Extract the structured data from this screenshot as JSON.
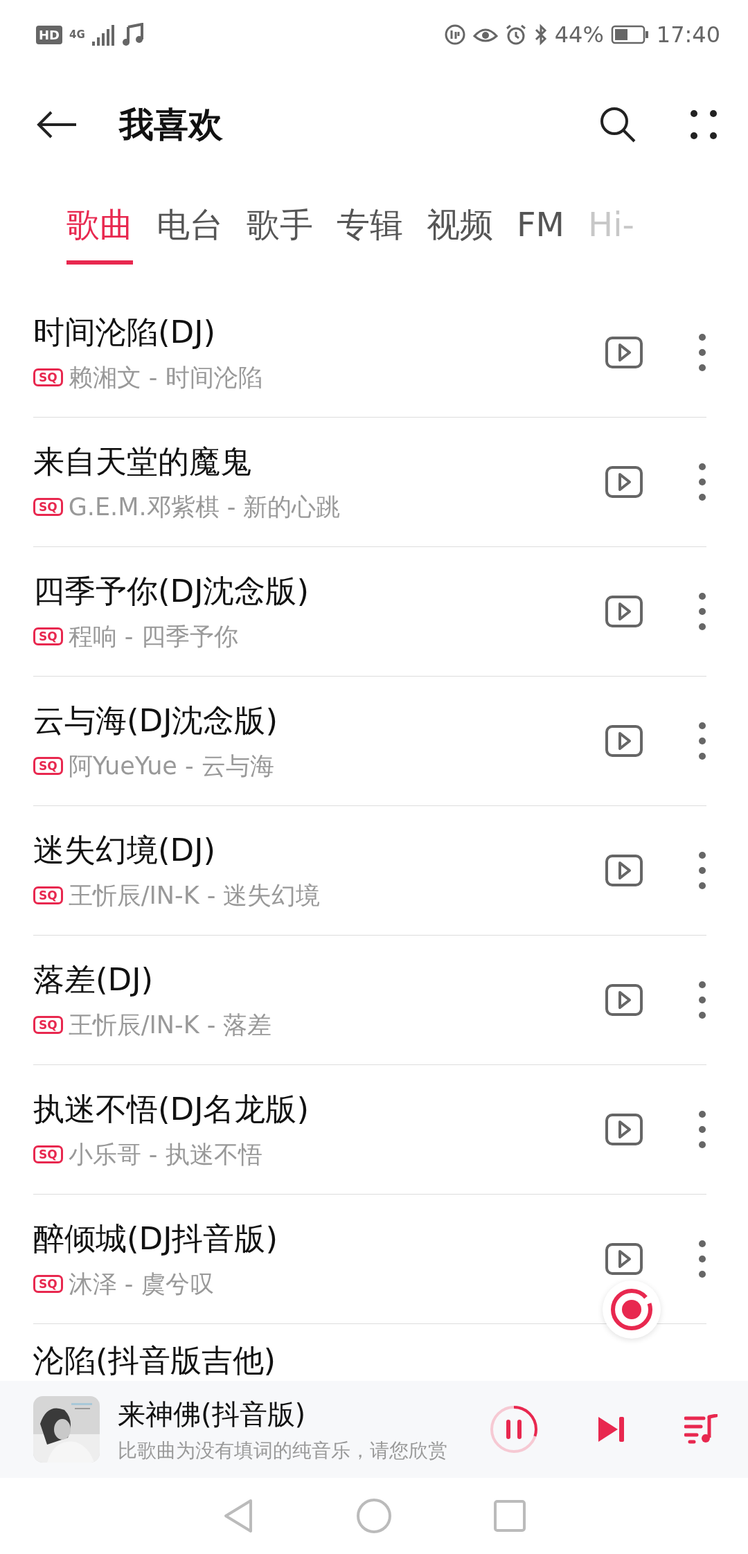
{
  "status_bar": {
    "hd": "HD",
    "network": "4G",
    "battery": "44%",
    "time": "17:40"
  },
  "header": {
    "title": "我喜欢"
  },
  "tabs": [
    {
      "label": "歌曲",
      "selected": true
    },
    {
      "label": "电台",
      "selected": false
    },
    {
      "label": "歌手",
      "selected": false
    },
    {
      "label": "专辑",
      "selected": false
    },
    {
      "label": "视频",
      "selected": false
    },
    {
      "label": "FM",
      "selected": false
    },
    {
      "label": "Hi-",
      "selected": false
    }
  ],
  "songs": [
    {
      "title": "时间沦陷(DJ)",
      "quality": "SQ",
      "subtitle": "赖湘文 - 时间沦陷"
    },
    {
      "title": "来自天堂的魔鬼",
      "quality": "SQ",
      "subtitle": "G.E.M.邓紫棋 - 新的心跳"
    },
    {
      "title": "四季予你(DJ沈念版)",
      "quality": "SQ",
      "subtitle": "程响 - 四季予你"
    },
    {
      "title": "云与海(DJ沈念版)",
      "quality": "SQ",
      "subtitle": "阿YueYue - 云与海"
    },
    {
      "title": "迷失幻境(DJ)",
      "quality": "SQ",
      "subtitle": "王忻辰/IN-K - 迷失幻境"
    },
    {
      "title": "落差(DJ)",
      "quality": "SQ",
      "subtitle": "王忻辰/IN-K - 落差"
    },
    {
      "title": "执迷不悟(DJ名龙版)",
      "quality": "SQ",
      "subtitle": "小乐哥 - 执迷不悟"
    },
    {
      "title": "醉倾城(DJ抖音版)",
      "quality": "SQ",
      "subtitle": "沐泽 - 虞兮叹"
    }
  ],
  "partial_song": {
    "title": "沦陷(抖音版吉他)"
  },
  "now_playing": {
    "title": "来神佛(抖音版)",
    "subtitle": "比歌曲为没有填词的纯音乐，请您欣赏",
    "playing": true,
    "level": 0.3
  }
}
